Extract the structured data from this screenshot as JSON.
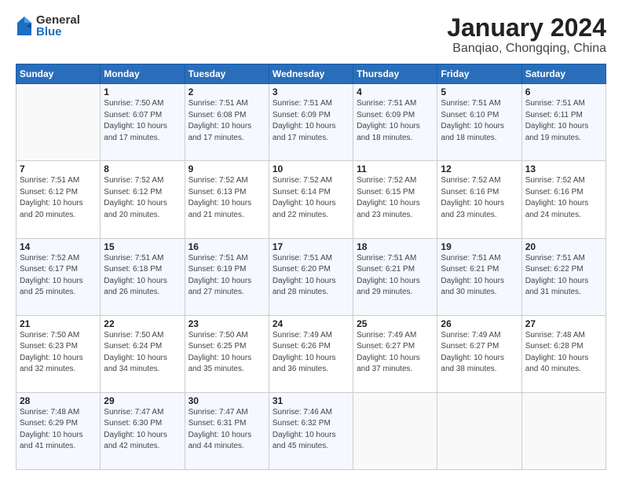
{
  "logo": {
    "general": "General",
    "blue": "Blue"
  },
  "title": "January 2024",
  "location": "Banqiao, Chongqing, China",
  "days_header": [
    "Sunday",
    "Monday",
    "Tuesday",
    "Wednesday",
    "Thursday",
    "Friday",
    "Saturday"
  ],
  "weeks": [
    [
      {
        "day": "",
        "info": ""
      },
      {
        "day": "1",
        "info": "Sunrise: 7:50 AM\nSunset: 6:07 PM\nDaylight: 10 hours\nand 17 minutes."
      },
      {
        "day": "2",
        "info": "Sunrise: 7:51 AM\nSunset: 6:08 PM\nDaylight: 10 hours\nand 17 minutes."
      },
      {
        "day": "3",
        "info": "Sunrise: 7:51 AM\nSunset: 6:09 PM\nDaylight: 10 hours\nand 17 minutes."
      },
      {
        "day": "4",
        "info": "Sunrise: 7:51 AM\nSunset: 6:09 PM\nDaylight: 10 hours\nand 18 minutes."
      },
      {
        "day": "5",
        "info": "Sunrise: 7:51 AM\nSunset: 6:10 PM\nDaylight: 10 hours\nand 18 minutes."
      },
      {
        "day": "6",
        "info": "Sunrise: 7:51 AM\nSunset: 6:11 PM\nDaylight: 10 hours\nand 19 minutes."
      }
    ],
    [
      {
        "day": "7",
        "info": "Sunrise: 7:51 AM\nSunset: 6:12 PM\nDaylight: 10 hours\nand 20 minutes."
      },
      {
        "day": "8",
        "info": "Sunrise: 7:52 AM\nSunset: 6:12 PM\nDaylight: 10 hours\nand 20 minutes."
      },
      {
        "day": "9",
        "info": "Sunrise: 7:52 AM\nSunset: 6:13 PM\nDaylight: 10 hours\nand 21 minutes."
      },
      {
        "day": "10",
        "info": "Sunrise: 7:52 AM\nSunset: 6:14 PM\nDaylight: 10 hours\nand 22 minutes."
      },
      {
        "day": "11",
        "info": "Sunrise: 7:52 AM\nSunset: 6:15 PM\nDaylight: 10 hours\nand 23 minutes."
      },
      {
        "day": "12",
        "info": "Sunrise: 7:52 AM\nSunset: 6:16 PM\nDaylight: 10 hours\nand 23 minutes."
      },
      {
        "day": "13",
        "info": "Sunrise: 7:52 AM\nSunset: 6:16 PM\nDaylight: 10 hours\nand 24 minutes."
      }
    ],
    [
      {
        "day": "14",
        "info": "Sunrise: 7:52 AM\nSunset: 6:17 PM\nDaylight: 10 hours\nand 25 minutes."
      },
      {
        "day": "15",
        "info": "Sunrise: 7:51 AM\nSunset: 6:18 PM\nDaylight: 10 hours\nand 26 minutes."
      },
      {
        "day": "16",
        "info": "Sunrise: 7:51 AM\nSunset: 6:19 PM\nDaylight: 10 hours\nand 27 minutes."
      },
      {
        "day": "17",
        "info": "Sunrise: 7:51 AM\nSunset: 6:20 PM\nDaylight: 10 hours\nand 28 minutes."
      },
      {
        "day": "18",
        "info": "Sunrise: 7:51 AM\nSunset: 6:21 PM\nDaylight: 10 hours\nand 29 minutes."
      },
      {
        "day": "19",
        "info": "Sunrise: 7:51 AM\nSunset: 6:21 PM\nDaylight: 10 hours\nand 30 minutes."
      },
      {
        "day": "20",
        "info": "Sunrise: 7:51 AM\nSunset: 6:22 PM\nDaylight: 10 hours\nand 31 minutes."
      }
    ],
    [
      {
        "day": "21",
        "info": "Sunrise: 7:50 AM\nSunset: 6:23 PM\nDaylight: 10 hours\nand 32 minutes."
      },
      {
        "day": "22",
        "info": "Sunrise: 7:50 AM\nSunset: 6:24 PM\nDaylight: 10 hours\nand 34 minutes."
      },
      {
        "day": "23",
        "info": "Sunrise: 7:50 AM\nSunset: 6:25 PM\nDaylight: 10 hours\nand 35 minutes."
      },
      {
        "day": "24",
        "info": "Sunrise: 7:49 AM\nSunset: 6:26 PM\nDaylight: 10 hours\nand 36 minutes."
      },
      {
        "day": "25",
        "info": "Sunrise: 7:49 AM\nSunset: 6:27 PM\nDaylight: 10 hours\nand 37 minutes."
      },
      {
        "day": "26",
        "info": "Sunrise: 7:49 AM\nSunset: 6:27 PM\nDaylight: 10 hours\nand 38 minutes."
      },
      {
        "day": "27",
        "info": "Sunrise: 7:48 AM\nSunset: 6:28 PM\nDaylight: 10 hours\nand 40 minutes."
      }
    ],
    [
      {
        "day": "28",
        "info": "Sunrise: 7:48 AM\nSunset: 6:29 PM\nDaylight: 10 hours\nand 41 minutes."
      },
      {
        "day": "29",
        "info": "Sunrise: 7:47 AM\nSunset: 6:30 PM\nDaylight: 10 hours\nand 42 minutes."
      },
      {
        "day": "30",
        "info": "Sunrise: 7:47 AM\nSunset: 6:31 PM\nDaylight: 10 hours\nand 44 minutes."
      },
      {
        "day": "31",
        "info": "Sunrise: 7:46 AM\nSunset: 6:32 PM\nDaylight: 10 hours\nand 45 minutes."
      },
      {
        "day": "",
        "info": ""
      },
      {
        "day": "",
        "info": ""
      },
      {
        "day": "",
        "info": ""
      }
    ]
  ]
}
